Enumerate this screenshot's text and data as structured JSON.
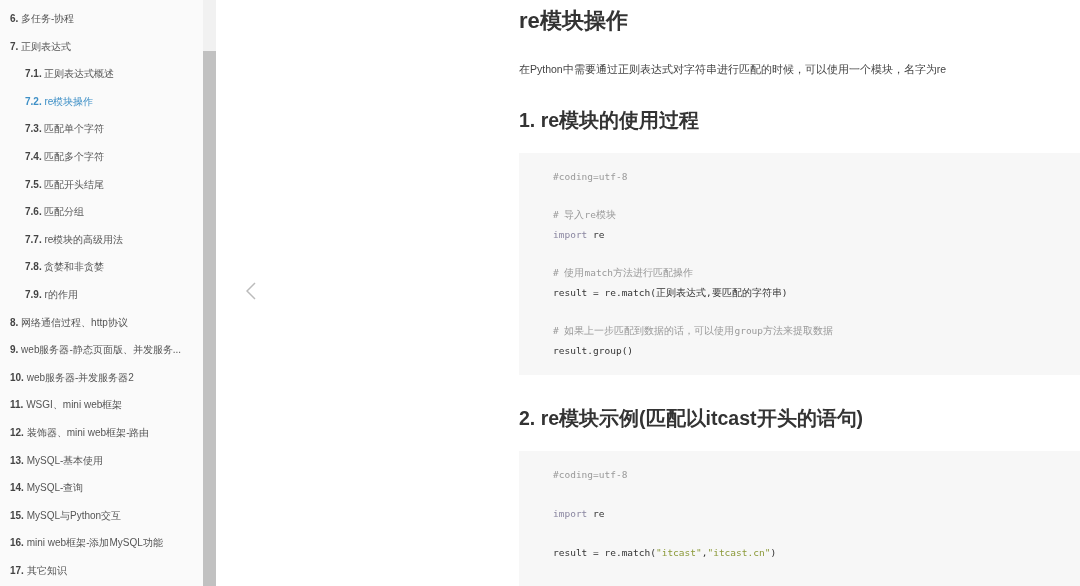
{
  "sidebar": {
    "items": [
      {
        "number": "6.",
        "label": "多任务-协程",
        "selected": false
      },
      {
        "number": "7.",
        "label": "正则表达式",
        "selected": false,
        "children": [
          {
            "number": "7.1.",
            "label": "正则表达式概述",
            "selected": false
          },
          {
            "number": "7.2.",
            "label": "re模块操作",
            "selected": true
          },
          {
            "number": "7.3.",
            "label": "匹配单个字符",
            "selected": false
          },
          {
            "number": "7.4.",
            "label": "匹配多个字符",
            "selected": false
          },
          {
            "number": "7.5.",
            "label": "匹配开头结尾",
            "selected": false
          },
          {
            "number": "7.6.",
            "label": "匹配分组",
            "selected": false
          },
          {
            "number": "7.7.",
            "label": "re模块的高级用法",
            "selected": false
          },
          {
            "number": "7.8.",
            "label": "贪婪和非贪婪",
            "selected": false
          },
          {
            "number": "7.9.",
            "label": "r的作用",
            "selected": false
          }
        ]
      },
      {
        "number": "8.",
        "label": "网络通信过程、http协议",
        "selected": false
      },
      {
        "number": "9.",
        "label": "web服务器-静态页面版、并发服务...",
        "selected": false
      },
      {
        "number": "10.",
        "label": "web服务器-并发服务器2",
        "selected": false
      },
      {
        "number": "11.",
        "label": "WSGI、mini web框架",
        "selected": false
      },
      {
        "number": "12.",
        "label": "装饰器、mini web框架-路由",
        "selected": false
      },
      {
        "number": "13.",
        "label": "MySQL-基本使用",
        "selected": false
      },
      {
        "number": "14.",
        "label": "MySQL-查询",
        "selected": false
      },
      {
        "number": "15.",
        "label": "MySQL与Python交互",
        "selected": false
      },
      {
        "number": "16.",
        "label": "mini web框架-添加MySQL功能",
        "selected": false
      },
      {
        "number": "17.",
        "label": "其它知识",
        "selected": false
      }
    ]
  },
  "article": {
    "title": "re模块操作",
    "blocks": [
      {
        "kind": "paragraph",
        "text": "在Python中需要通过正则表达式对字符串进行匹配的时候，可以使用一个模块，名字为re"
      },
      {
        "kind": "heading",
        "text": "1. re模块的使用过程"
      },
      {
        "kind": "code",
        "lines": [
          {
            "kind": "line",
            "parts": [
              {
                "kind": "comment",
                "text": "#coding=utf-8"
              }
            ]
          },
          {
            "kind": "blank"
          },
          {
            "kind": "line",
            "parts": [
              {
                "kind": "comment",
                "text": "# 导入re模块"
              }
            ]
          },
          {
            "kind": "line",
            "parts": [
              {
                "kind": "keyword",
                "text": "import"
              },
              {
                "kind": "plain",
                "text": " re"
              }
            ]
          },
          {
            "kind": "blank"
          },
          {
            "kind": "line",
            "parts": [
              {
                "kind": "comment",
                "text": "# 使用match方法进行匹配操作"
              }
            ]
          },
          {
            "kind": "line",
            "parts": [
              {
                "kind": "plain",
                "text": "result = re.match(正则表达式,要匹配的字符串)"
              }
            ]
          },
          {
            "kind": "blank"
          },
          {
            "kind": "line",
            "parts": [
              {
                "kind": "comment",
                "text": "# 如果上一步匹配到数据的话，可以使用group方法来提取数据"
              }
            ]
          },
          {
            "kind": "line",
            "parts": [
              {
                "kind": "plain",
                "text": "result.group()"
              }
            ]
          }
        ]
      },
      {
        "kind": "heading",
        "text": "2. re模块示例(匹配以itcast开头的语句)"
      },
      {
        "kind": "code",
        "lines": [
          {
            "kind": "line",
            "parts": [
              {
                "kind": "comment",
                "text": "#coding=utf-8"
              }
            ]
          },
          {
            "kind": "blank"
          },
          {
            "kind": "line",
            "parts": [
              {
                "kind": "keyword",
                "text": "import"
              },
              {
                "kind": "plain",
                "text": " re"
              }
            ]
          },
          {
            "kind": "blank"
          },
          {
            "kind": "line",
            "parts": [
              {
                "kind": "plain",
                "text": "result = re.match("
              },
              {
                "kind": "string",
                "text": "\"itcast\""
              },
              {
                "kind": "plain",
                "text": ","
              },
              {
                "kind": "string",
                "text": "\"itcast.cn\""
              },
              {
                "kind": "plain",
                "text": ")"
              }
            ]
          }
        ]
      }
    ]
  }
}
